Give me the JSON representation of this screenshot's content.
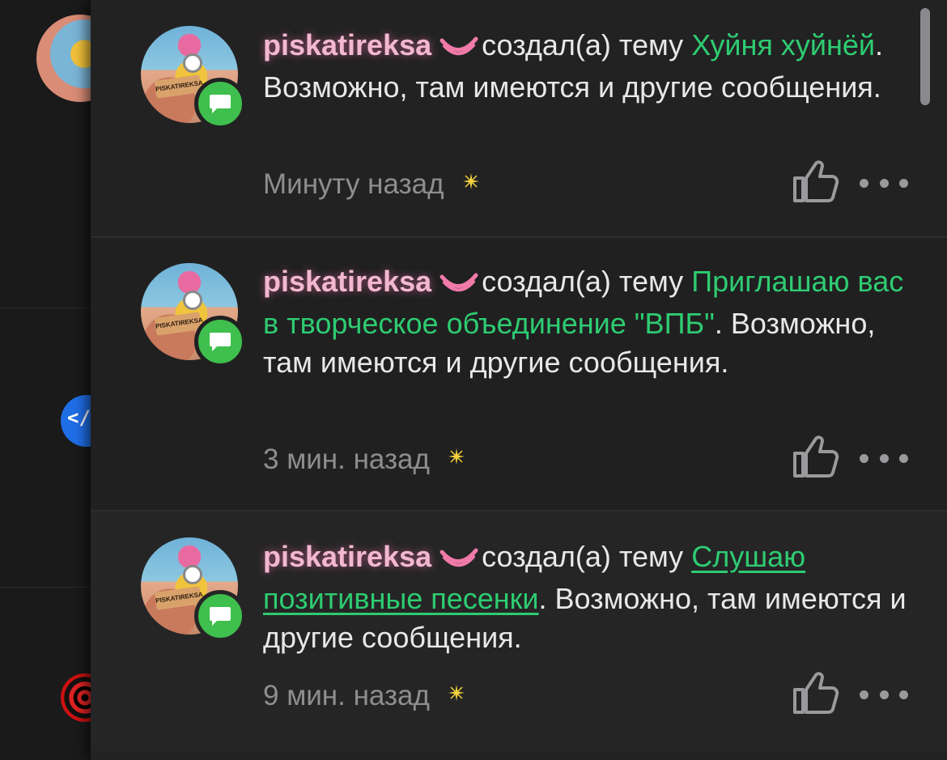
{
  "notifications": [
    {
      "username": "piskatireksa",
      "action": "создал(а) тему",
      "topic": "Хуйня хуйнёй",
      "suffix": ". Возможно, там имеются и другие сообщения.",
      "time": "Минуту назад",
      "topic_underlined": false
    },
    {
      "username": "piskatireksa",
      "action": "создал(а) тему",
      "topic": "Приглашаю вас в творческое объединение \"ВПБ\"",
      "suffix": ". Возможно, там имеются и другие сообщения.",
      "time": "3 мин. назад",
      "topic_underlined": false
    },
    {
      "username": "piskatireksa",
      "action": "создал(а) тему",
      "topic": "Слушаю позитивные песенки",
      "suffix": ". Возможно, там имеются и другие сообщения.",
      "time": "9 мин. назад",
      "topic_underlined": true
    }
  ],
  "avatar_sign_text": "PISKATIREKSA",
  "icons": {
    "badge": "message-icon",
    "banana": "banana-icon",
    "time_marker": "sparkle-icon",
    "like": "thumbs-up-icon",
    "more": "more-dots-icon",
    "bg_code_glyph": "</"
  },
  "colors": {
    "background": "#222223",
    "username": "#f2b8cf",
    "topic_link": "#2ecc71",
    "badge": "#3fbf4d",
    "meta_text": "#8e8e91"
  }
}
